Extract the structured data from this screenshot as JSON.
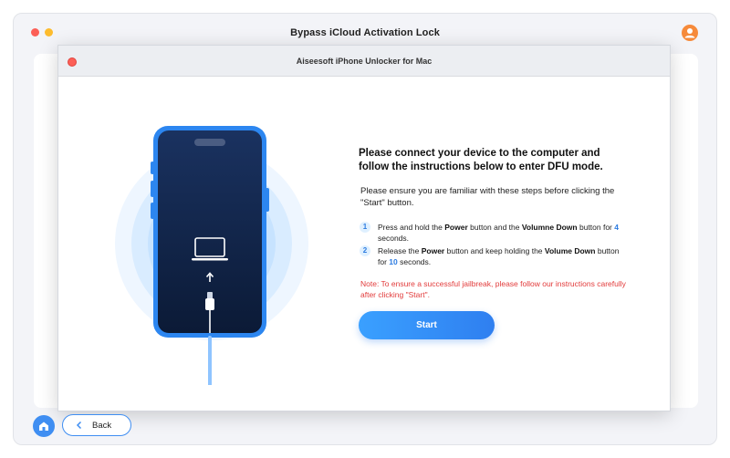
{
  "outer_window": {
    "title": "Bypass iCloud Activation Lock"
  },
  "dialog": {
    "title": "Aiseesoft iPhone Unlocker for Mac",
    "heading": "Please connect your device to the computer and follow the instructions below to enter DFU mode.",
    "ensure_text": "Please ensure you are familiar with these steps before clicking the \"Start\" button.",
    "steps": [
      {
        "number": "1",
        "pre": "Press and hold the ",
        "b1": "Power",
        "mid": " button and the ",
        "b2": "Volumne Down",
        "mid2": " button for ",
        "value": "4",
        "post": " seconds."
      },
      {
        "number": "2",
        "pre": "Release the ",
        "b1": "Power",
        "mid": " button and keep holding the ",
        "b2": "Volume Down",
        "mid2": " button for ",
        "value": "10",
        "post": " seconds."
      }
    ],
    "note": "Note: To ensure a successful jailbreak, please follow our instructions carefully after clicking \"Start\".",
    "start_label": "Start"
  },
  "bottom": {
    "back_label": "Back"
  },
  "icons": [
    "home-icon",
    "chevron-left-icon",
    "laptop-icon",
    "arrow-up-icon",
    "user-icon"
  ],
  "colors": {
    "accent": "#2f7ff0",
    "note": "#e23b3b",
    "phone_frame": "#2c86f0",
    "screen": "#102345"
  }
}
